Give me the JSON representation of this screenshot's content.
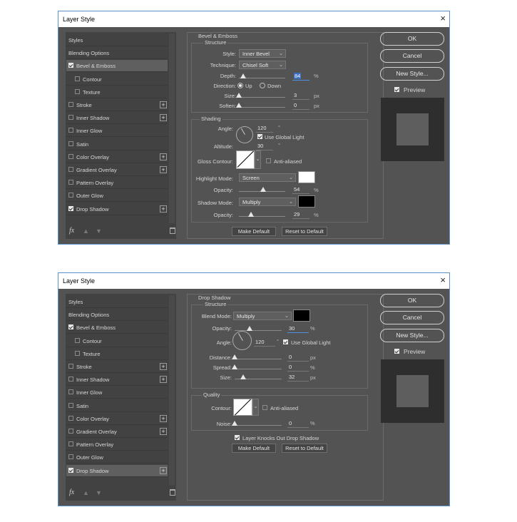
{
  "dialog1": {
    "title": "Layer Style",
    "close": "×",
    "left": {
      "items": [
        {
          "label": "Styles",
          "checkbox": null,
          "plus": false,
          "indent": false,
          "selected": false
        },
        {
          "label": "Blending Options",
          "checkbox": null,
          "plus": false,
          "indent": false,
          "selected": false
        },
        {
          "label": "Bevel & Emboss",
          "checkbox": true,
          "plus": false,
          "indent": false,
          "selected": true
        },
        {
          "label": "Contour",
          "checkbox": false,
          "plus": false,
          "indent": true,
          "selected": false
        },
        {
          "label": "Texture",
          "checkbox": false,
          "plus": false,
          "indent": true,
          "selected": false
        },
        {
          "label": "Stroke",
          "checkbox": false,
          "plus": true,
          "indent": false,
          "selected": false
        },
        {
          "label": "Inner Shadow",
          "checkbox": false,
          "plus": true,
          "indent": false,
          "selected": false
        },
        {
          "label": "Inner Glow",
          "checkbox": false,
          "plus": false,
          "indent": false,
          "selected": false
        },
        {
          "label": "Satin",
          "checkbox": false,
          "plus": false,
          "indent": false,
          "selected": false
        },
        {
          "label": "Color Overlay",
          "checkbox": false,
          "plus": true,
          "indent": false,
          "selected": false
        },
        {
          "label": "Gradient Overlay",
          "checkbox": false,
          "plus": true,
          "indent": false,
          "selected": false
        },
        {
          "label": "Pattern Overlay",
          "checkbox": false,
          "plus": false,
          "indent": false,
          "selected": false
        },
        {
          "label": "Outer Glow",
          "checkbox": false,
          "plus": false,
          "indent": false,
          "selected": false
        },
        {
          "label": "Drop Shadow",
          "checkbox": true,
          "plus": true,
          "indent": false,
          "selected": false
        }
      ],
      "fx": "fx"
    },
    "panel": {
      "section": "Bevel & Emboss",
      "structure": "Structure",
      "style_label": "Style:",
      "style_value": "Inner Bevel",
      "technique_label": "Technique:",
      "technique_value": "Chisel Soft",
      "depth_label": "Depth:",
      "depth_value": "84",
      "depth_unit": "%",
      "direction_label": "Direction:",
      "dir_up": "Up",
      "dir_down": "Down",
      "size_label": "Size:",
      "size_value": "3",
      "size_unit": "px",
      "soften_label": "Soften:",
      "soften_value": "0",
      "soften_unit": "px",
      "shading": "Shading",
      "angle_label": "Angle:",
      "angle_value": "120",
      "angle_unit": "°",
      "global_light": "Use Global Light",
      "altitude_label": "Altitude:",
      "altitude_value": "30",
      "altitude_unit": "°",
      "gloss_label": "Gloss Contour:",
      "anti_aliased": "Anti-aliased",
      "highlight_label": "Highlight Mode:",
      "highlight_value": "Screen",
      "highlight_color": "#ffffff",
      "hopacity_label": "Opacity:",
      "hopacity_value": "54",
      "hopacity_unit": "%",
      "shadow_label": "Shadow Mode:",
      "shadow_value": "Multiply",
      "shadow_color": "#000000",
      "sopacity_label": "Opacity:",
      "sopacity_value": "29",
      "sopacity_unit": "%",
      "make_default": "Make Default",
      "reset_default": "Reset to Default"
    },
    "right": {
      "ok": "OK",
      "cancel": "Cancel",
      "new_style": "New Style...",
      "preview": "Preview"
    }
  },
  "dialog2": {
    "title": "Layer Style",
    "close": "×",
    "left": {
      "items": [
        {
          "label": "Styles",
          "checkbox": null,
          "plus": false,
          "indent": false,
          "selected": false
        },
        {
          "label": "Blending Options",
          "checkbox": null,
          "plus": false,
          "indent": false,
          "selected": false
        },
        {
          "label": "Bevel & Emboss",
          "checkbox": true,
          "plus": false,
          "indent": false,
          "selected": false
        },
        {
          "label": "Contour",
          "checkbox": false,
          "plus": false,
          "indent": true,
          "selected": false
        },
        {
          "label": "Texture",
          "checkbox": false,
          "plus": false,
          "indent": true,
          "selected": false
        },
        {
          "label": "Stroke",
          "checkbox": false,
          "plus": true,
          "indent": false,
          "selected": false
        },
        {
          "label": "Inner Shadow",
          "checkbox": false,
          "plus": true,
          "indent": false,
          "selected": false
        },
        {
          "label": "Inner Glow",
          "checkbox": false,
          "plus": false,
          "indent": false,
          "selected": false
        },
        {
          "label": "Satin",
          "checkbox": false,
          "plus": false,
          "indent": false,
          "selected": false
        },
        {
          "label": "Color Overlay",
          "checkbox": false,
          "plus": true,
          "indent": false,
          "selected": false
        },
        {
          "label": "Gradient Overlay",
          "checkbox": false,
          "plus": true,
          "indent": false,
          "selected": false
        },
        {
          "label": "Pattern Overlay",
          "checkbox": false,
          "plus": false,
          "indent": false,
          "selected": false
        },
        {
          "label": "Outer Glow",
          "checkbox": false,
          "plus": false,
          "indent": false,
          "selected": false
        },
        {
          "label": "Drop Shadow",
          "checkbox": true,
          "plus": true,
          "indent": false,
          "selected": true
        }
      ],
      "fx": "fx"
    },
    "panel": {
      "section": "Drop Shadow",
      "structure": "Structure",
      "blend_label": "Blend Mode:",
      "blend_value": "Multiply",
      "blend_color": "#000000",
      "opacity_label": "Opacity:",
      "opacity_value": "30",
      "opacity_unit": "%",
      "angle_label": "Angle:",
      "angle_value": "120",
      "angle_unit": "°",
      "global_light": "Use Global Light",
      "distance_label": "Distance:",
      "distance_value": "0",
      "distance_unit": "px",
      "spread_label": "Spread:",
      "spread_value": "0",
      "spread_unit": "%",
      "size_label": "Size:",
      "size_value": "32",
      "size_unit": "px",
      "quality": "Quality",
      "contour_label": "Contour:",
      "anti_aliased": "Anti-aliased",
      "noise_label": "Noise:",
      "noise_value": "0",
      "noise_unit": "%",
      "knockout": "Layer Knocks Out Drop Shadow",
      "make_default": "Make Default",
      "reset_default": "Reset to Default"
    },
    "right": {
      "ok": "OK",
      "cancel": "Cancel",
      "new_style": "New Style...",
      "preview": "Preview"
    }
  }
}
